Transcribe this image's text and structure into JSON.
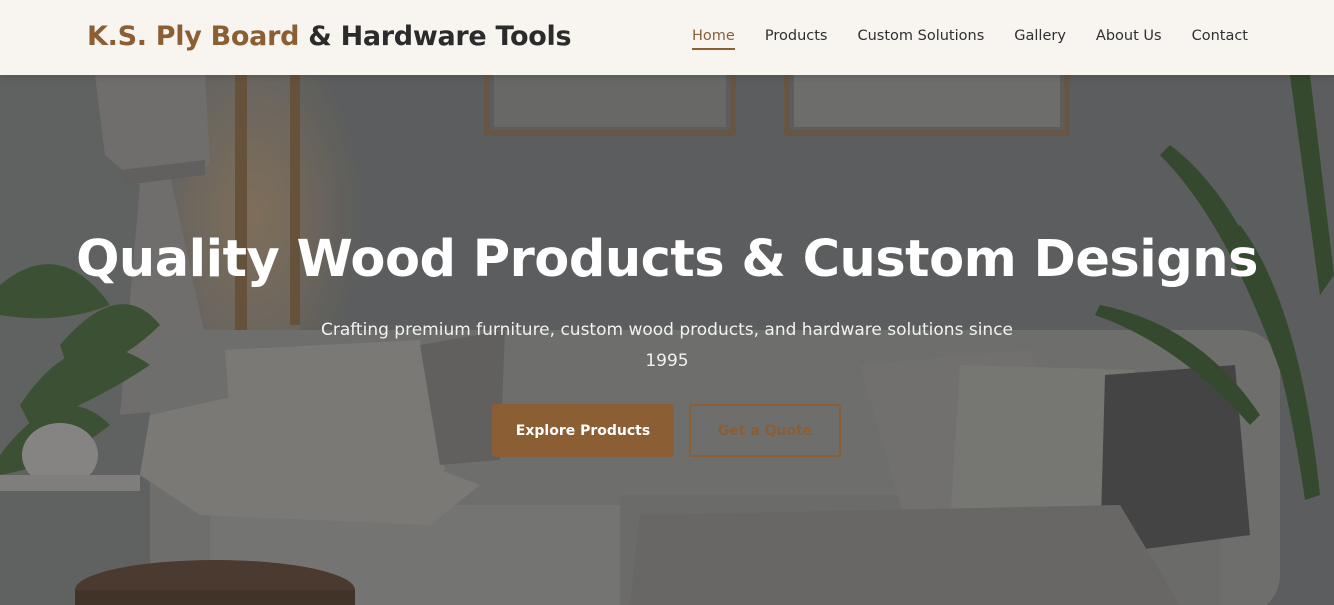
{
  "brand": {
    "name_accent": "K.S. Ply Board",
    "name_rest": " & Hardware Tools"
  },
  "nav": {
    "items": [
      {
        "label": "Home",
        "active": true
      },
      {
        "label": "Products",
        "active": false
      },
      {
        "label": "Custom Solutions",
        "active": false
      },
      {
        "label": "Gallery",
        "active": false
      },
      {
        "label": "About Us",
        "active": false
      },
      {
        "label": "Contact",
        "active": false
      }
    ]
  },
  "hero": {
    "title": "Quality Wood Products & Custom Designs",
    "subtitle": "Crafting premium furniture, custom wood products, and hardware solutions since 1995",
    "primary_button": "Explore Products",
    "secondary_button": "Get a Quote"
  },
  "colors": {
    "accent": "#8b5e34",
    "navbar_bg": "#f8f5f1",
    "text_dark": "#2b2b2b"
  }
}
